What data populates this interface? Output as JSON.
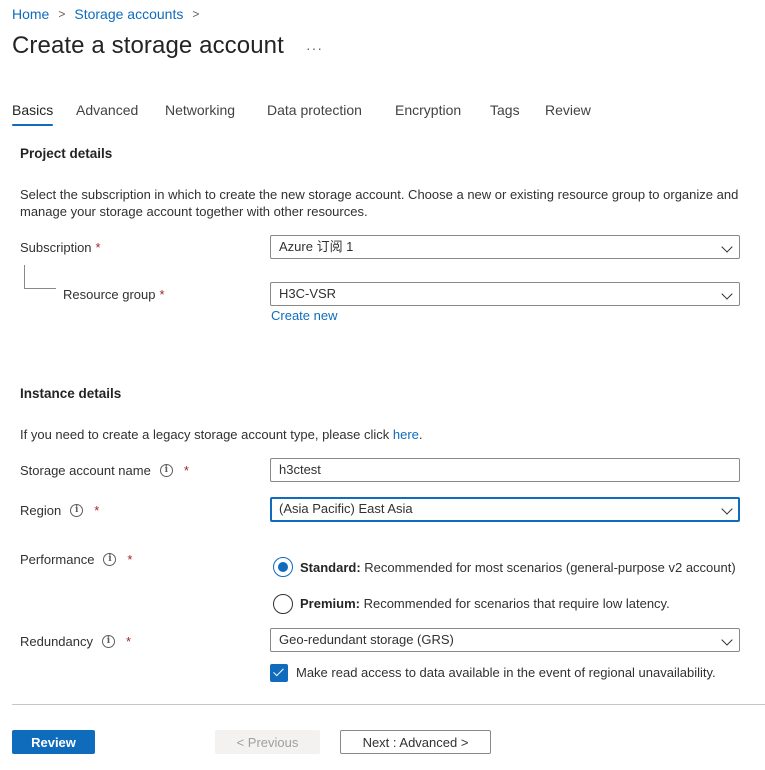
{
  "breadcrumb": {
    "items": [
      "Home",
      "Storage accounts"
    ],
    "separator": ">"
  },
  "page": {
    "title": "Create a storage account",
    "more": "···"
  },
  "tabs": [
    {
      "label": "Basics",
      "active": true
    },
    {
      "label": "Advanced"
    },
    {
      "label": "Networking"
    },
    {
      "label": "Data protection"
    },
    {
      "label": "Encryption"
    },
    {
      "label": "Tags"
    },
    {
      "label": "Review"
    }
  ],
  "project": {
    "heading": "Project details",
    "description": "Select the subscription in which to create the new storage account. Choose a new or existing resource group to organize and manage your storage account together with other resources.",
    "subscription_label": "Subscription",
    "subscription_value": "Azure 订阅 1",
    "resource_group_label": "Resource group",
    "resource_group_value": "H3C-VSR",
    "create_new": "Create new"
  },
  "instance": {
    "heading": "Instance details",
    "legacy_text": "If you need to create a legacy storage account type, please click ",
    "legacy_link": "here",
    "legacy_end": ".",
    "name_label": "Storage account name",
    "name_value": "h3ctest",
    "region_label": "Region",
    "region_value": "(Asia Pacific) East Asia",
    "performance_label": "Performance",
    "standard_title": "Standard:",
    "standard_desc": " Recommended for most scenarios (general-purpose v2 account)",
    "premium_title": "Premium:",
    "premium_desc": " Recommended for scenarios that require low latency.",
    "redundancy_label": "Redundancy",
    "redundancy_value": "Geo-redundant storage (GRS)",
    "read_access_label": "Make read access to data available in the event of regional unavailability.",
    "required_mark": "*",
    "info_glyph": "i"
  },
  "footer": {
    "review": "Review",
    "previous": "< Previous",
    "next": "Next : Advanced >"
  },
  "colors": {
    "accent": "#0f6cbd",
    "required": "#a4262c"
  }
}
